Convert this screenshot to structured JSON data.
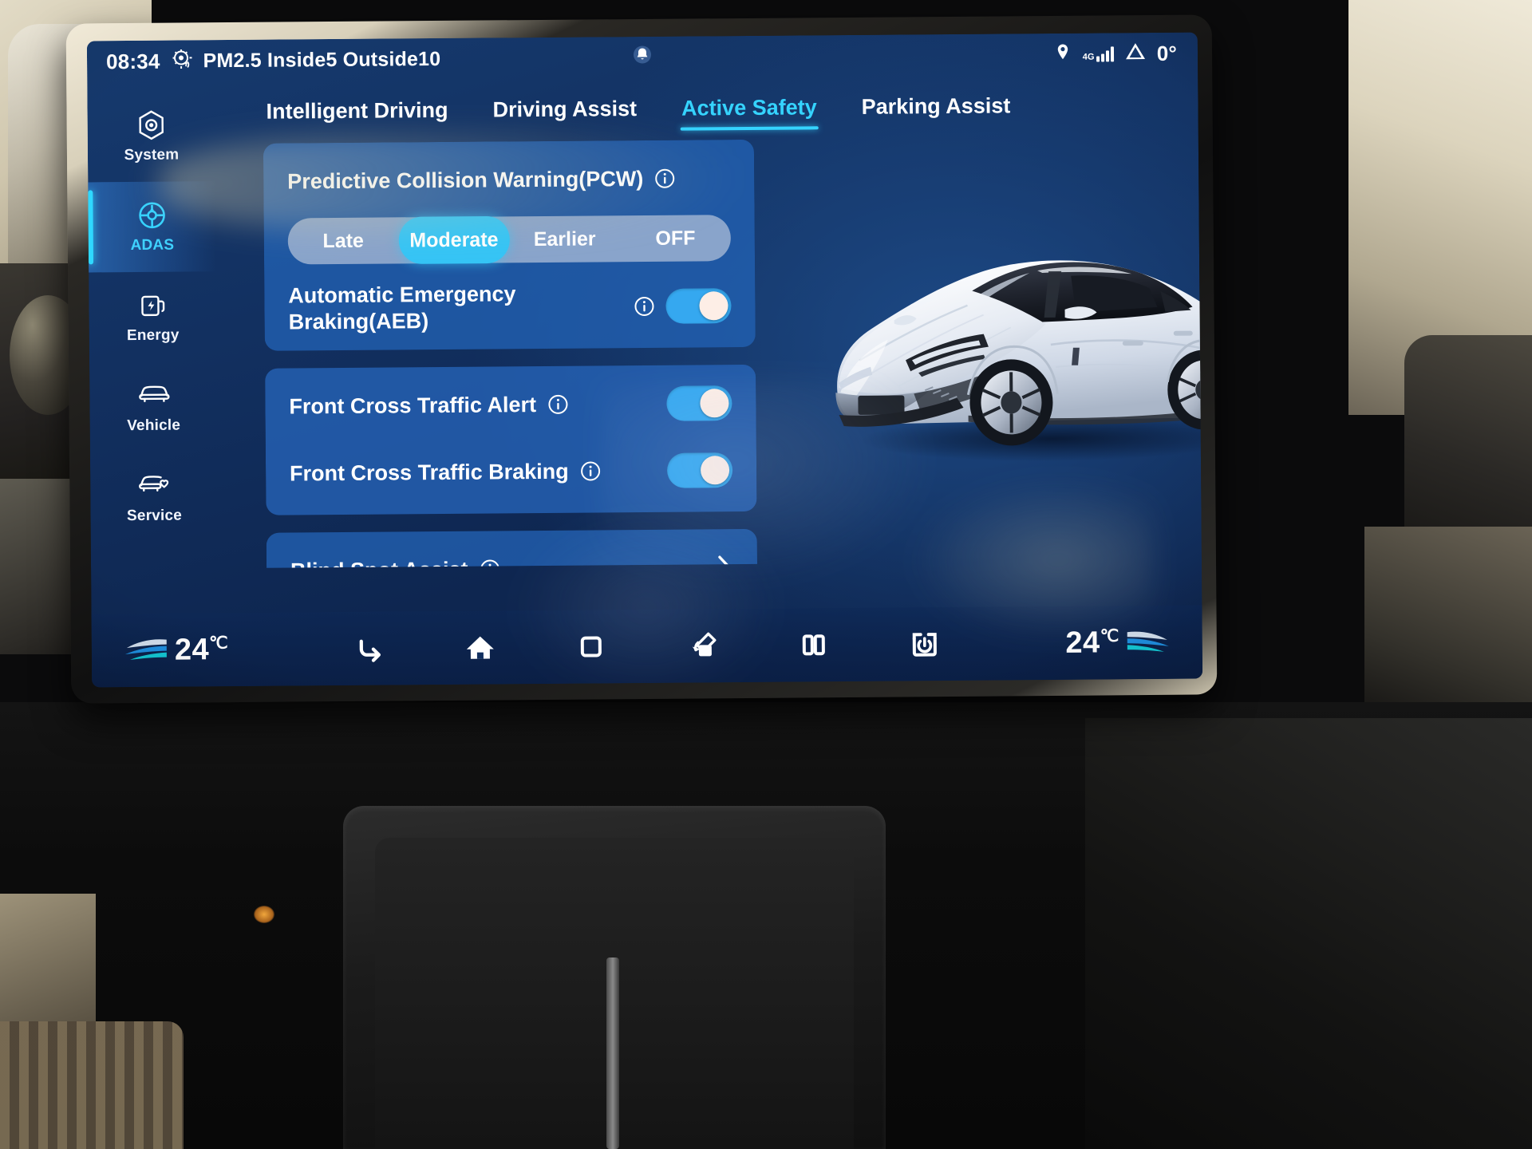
{
  "status_bar": {
    "time": "08:34",
    "air_quality": "PM2.5 Inside5 Outside10",
    "air_icon": "air-purifier-icon",
    "notification_icon": "bell-icon",
    "location_icon": "location-pin-icon",
    "network_label": "4G",
    "signal_icon": "signal-bars-icon",
    "warning_icon": "warning-triangle-icon",
    "outside_temp": "0°"
  },
  "sidebar": {
    "items": [
      {
        "label": "System",
        "icon": "hex-gear-icon",
        "active": false
      },
      {
        "label": "ADAS",
        "icon": "steering-wheel-icon",
        "active": true
      },
      {
        "label": "Energy",
        "icon": "charging-plug-icon",
        "active": false
      },
      {
        "label": "Vehicle",
        "icon": "car-front-icon",
        "active": false
      },
      {
        "label": "Service",
        "icon": "car-heart-icon",
        "active": false
      }
    ]
  },
  "tabs": [
    {
      "label": "Intelligent Driving",
      "active": false
    },
    {
      "label": "Driving Assist",
      "active": false
    },
    {
      "label": "Active Safety",
      "active": true
    },
    {
      "label": "Parking Assist",
      "active": false
    }
  ],
  "settings": {
    "pcw": {
      "label": "Predictive Collision Warning(PCW)",
      "info_icon": "info-icon",
      "options": [
        "Late",
        "Moderate",
        "Earlier",
        "OFF"
      ],
      "selected": "Moderate"
    },
    "aeb": {
      "label": "Automatic Emergency Braking(AEB)",
      "info_icon": "info-icon",
      "toggle": "on"
    },
    "fcta": {
      "label": "Front Cross Traffic Alert",
      "info_icon": "info-icon",
      "toggle": "on"
    },
    "fctb": {
      "label": "Front Cross Traffic Braking",
      "info_icon": "info-icon",
      "toggle": "on"
    },
    "blind_spot": {
      "label": "Blind Spot Assist",
      "info_icon": "info-icon",
      "chevron_icon": "chevron-right-icon"
    }
  },
  "vehicle_image": {
    "alt": "white-sedan-render",
    "body_color": "#e9eef5"
  },
  "navbar": {
    "left_temp": "24",
    "left_unit": "℃",
    "right_temp": "24",
    "right_unit": "℃",
    "airflow_icon": "airflow-wave-icon",
    "buttons": [
      {
        "icon": "back-arrow-icon"
      },
      {
        "icon": "home-icon"
      },
      {
        "icon": "recents-square-icon"
      },
      {
        "icon": "screen-rotate-icon"
      },
      {
        "icon": "split-screen-icon"
      },
      {
        "icon": "screen-off-power-icon"
      }
    ]
  },
  "colors": {
    "accent_cyan": "#35d3ff",
    "toggle_on": "#35a8f0",
    "card_blue": "#2260b2",
    "screen_bg": "#123060",
    "segment_selected": "#35c4f5"
  }
}
